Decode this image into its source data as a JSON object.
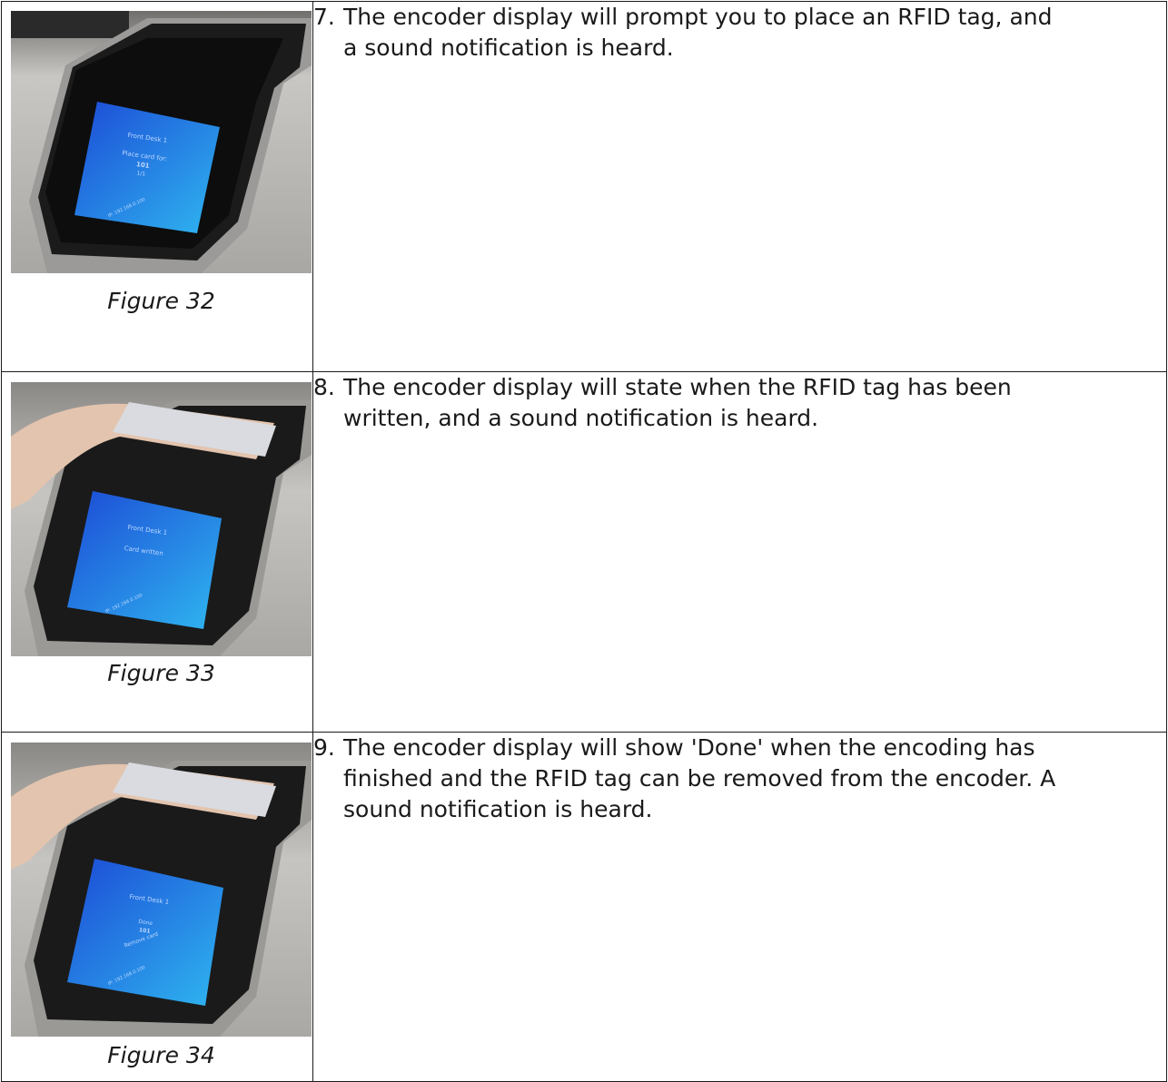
{
  "steps": [
    {
      "number": "7.",
      "text": "The encoder display will prompt you to place an RFID tag, and a sound notification is heard.",
      "caption": "Figure 32",
      "screen": {
        "line1": "Front Desk 1",
        "line2": "Place card for:",
        "line3": "101",
        "line4": "1/1",
        "footer": "IP: 192.168.0.100"
      }
    },
    {
      "number": "8.",
      "text": "The encoder display will state when the RFID tag has been written, and a sound notification is heard.",
      "caption": "Figure 33",
      "screen": {
        "line1": "Front Desk 1",
        "line2": "Card written",
        "footer": "IP: 192.168.0.100"
      }
    },
    {
      "number": "9.",
      "text": "The encoder display will show 'Done' when the encoding has finished and the RFID tag can be removed from the encoder. A sound notification is heard.",
      "caption": "Figure 34",
      "screen": {
        "line1": "Front Desk 1",
        "line2": "Done",
        "line3": "101",
        "line4": "Remove card",
        "footer": "IP: 192.168.0.100"
      }
    }
  ]
}
